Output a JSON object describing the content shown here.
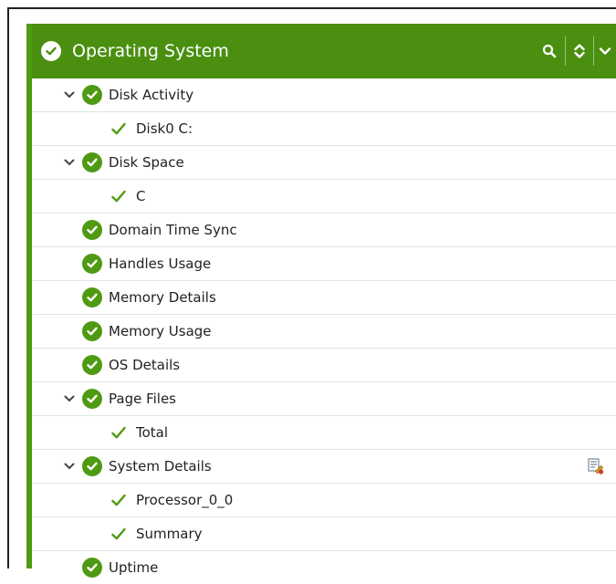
{
  "header": {
    "title": "Operating System",
    "status_icon": "check-circle-icon",
    "tools": [
      "search-icon",
      "sort-icon",
      "chevron-down-icon"
    ]
  },
  "colors": {
    "header_bg": "#4a8f10",
    "ok_green": "#4f9a13",
    "row_border": "#dfe4e8"
  },
  "rows": [
    {
      "label": "Disk Activity",
      "level": 0,
      "expanded": true
    },
    {
      "label": "Disk0 C:",
      "level": 1
    },
    {
      "label": "Disk Space",
      "level": 0,
      "expanded": true
    },
    {
      "label": "C",
      "level": 1
    },
    {
      "label": "Domain Time Sync",
      "level": 0
    },
    {
      "label": "Handles Usage",
      "level": 0
    },
    {
      "label": "Memory Details",
      "level": 0
    },
    {
      "label": "Memory Usage",
      "level": 0
    },
    {
      "label": "OS Details",
      "level": 0
    },
    {
      "label": "Page Files",
      "level": 0,
      "expanded": true
    },
    {
      "label": "Total",
      "level": 1
    },
    {
      "label": "System Details",
      "level": 0,
      "expanded": true,
      "action_icon": "edit-report-icon"
    },
    {
      "label": "Processor_0_0",
      "level": 1
    },
    {
      "label": "Summary",
      "level": 1
    },
    {
      "label": "Uptime",
      "level": 0
    }
  ]
}
